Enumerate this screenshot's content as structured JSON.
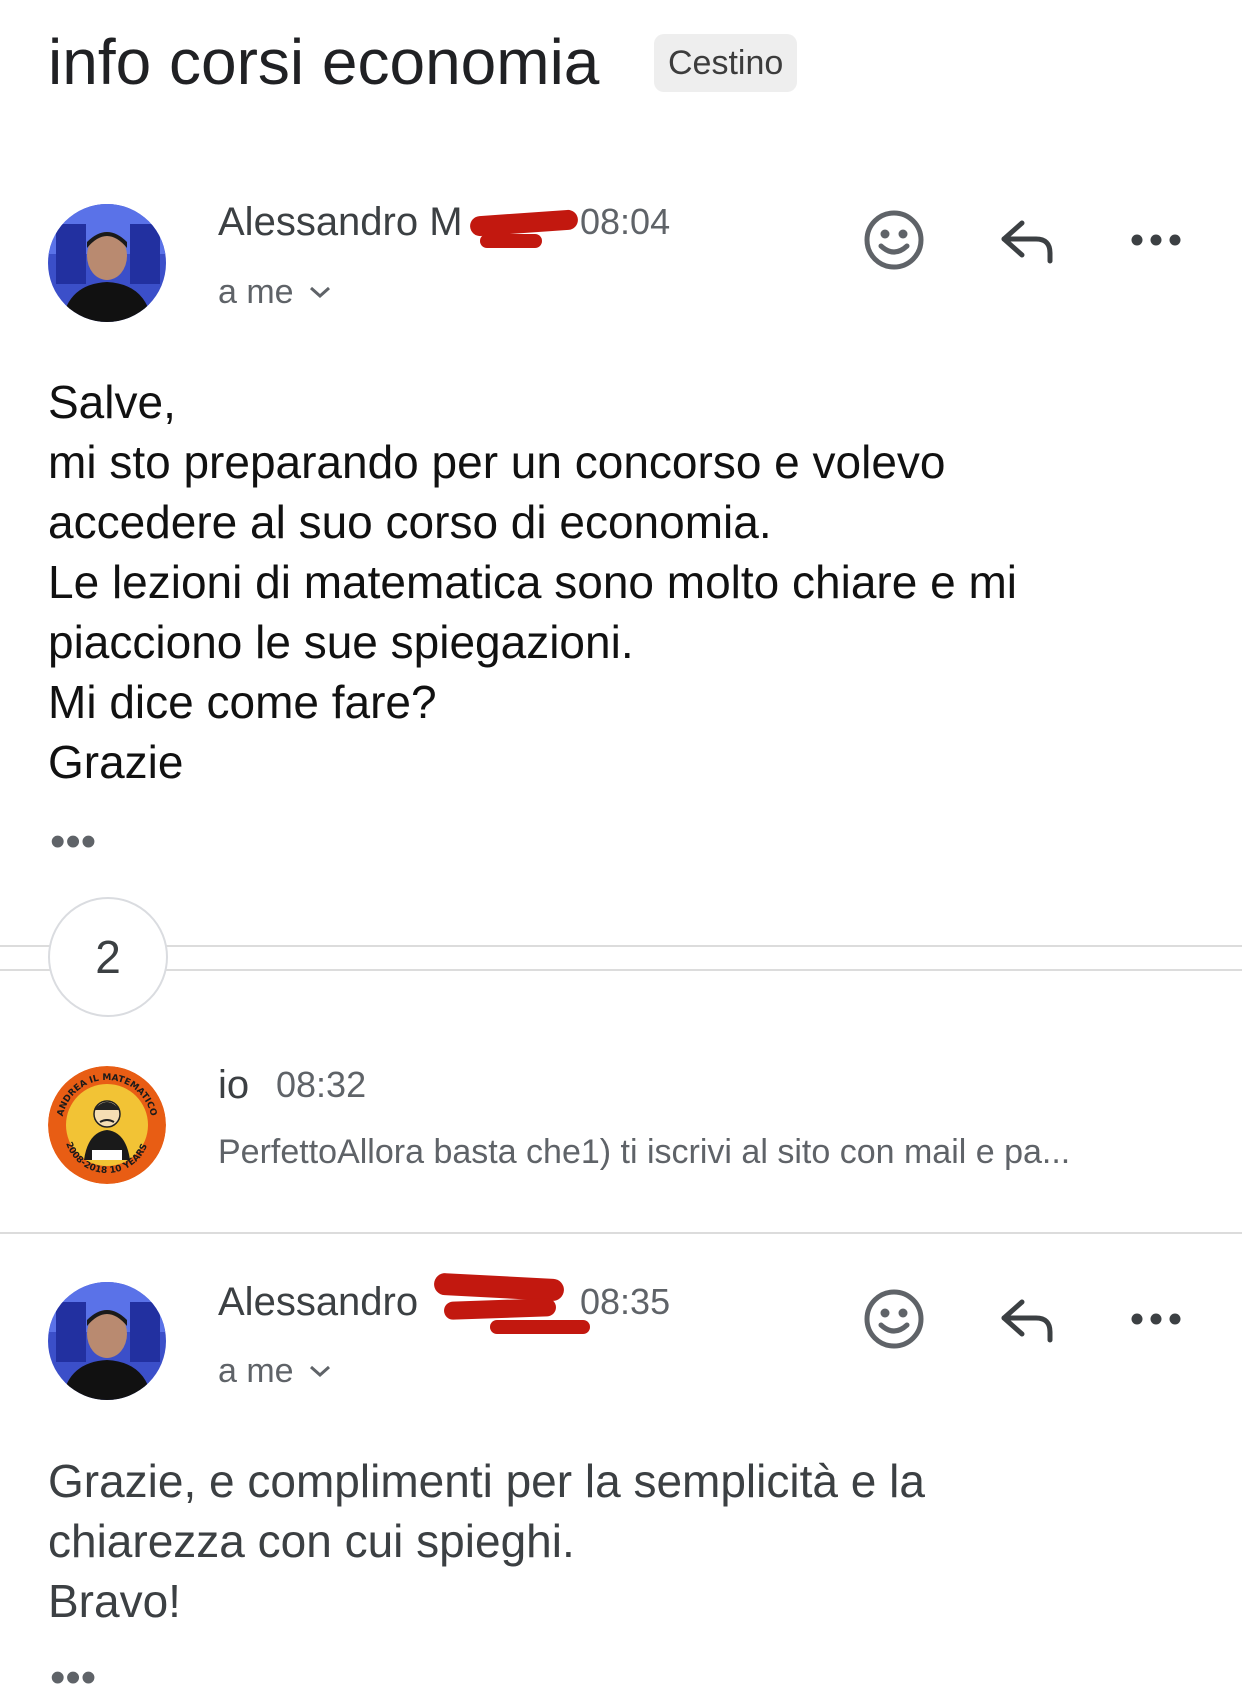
{
  "thread": {
    "subject": "info corsi economia",
    "label": "Cestino",
    "collapsed_count": "2"
  },
  "messages": [
    {
      "sender": "Alessandro M",
      "time": "08:04",
      "recipient": "a me",
      "body": [
        "Salve,",
        "mi sto preparando per un concorso e volevo",
        "accedere al suo corso di economia.",
        "Le lezioni di matematica sono molto chiare e mi",
        "piacciono le sue spiegazioni.",
        "Mi dice come fare?",
        "Grazie"
      ],
      "more": "•••"
    },
    {
      "sender": "io",
      "time": "08:32",
      "snippet": "PerfettoAllora basta che1) ti iscrivi al sito con mail e pa...",
      "avatar_text_top": "ANDREA IL MATEMATICO",
      "avatar_text_bottom": "2008-2018 10 YEARS"
    },
    {
      "sender": "Alessandro",
      "time": "08:35",
      "recipient": "a me",
      "body": [
        "Grazie, e complimenti per la semplicità e la",
        "chiarezza con cui spieghi.",
        "Bravo!"
      ],
      "more": "•••"
    }
  ],
  "colors": {
    "text": "#202124",
    "secondary": "#5f6368",
    "redaction": "#c2180f",
    "badge_bg": "#eeeeee",
    "divider": "#dcdcdc"
  },
  "icons": [
    "emoji-reaction-icon",
    "reply-icon",
    "more-options-icon",
    "chevron-down-icon"
  ]
}
